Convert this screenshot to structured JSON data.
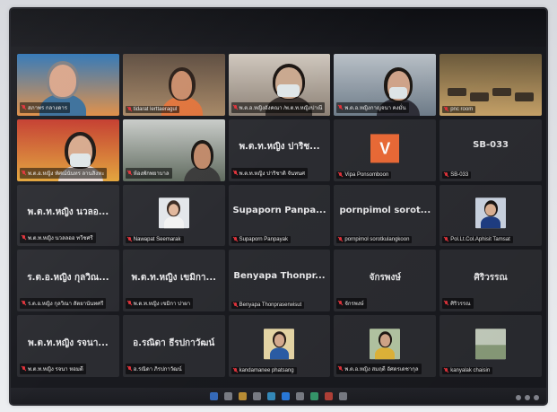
{
  "participants": [
    {
      "tag": "สภาพร กลางดาร",
      "type": "video"
    },
    {
      "tag": "tidarat lerttaeragul",
      "type": "video"
    },
    {
      "tag": "พ.ต.อ.หญิงอังคณา /พ.ต.ท.หญิงปาณี",
      "type": "video",
      "active": true
    },
    {
      "tag": "พ.ต.อ.หญิงกาญจนา คงมั่น",
      "type": "video"
    },
    {
      "tag": "pnc room",
      "type": "video"
    },
    {
      "tag": "พ.ต.อ.หญิง ทัศณ์นันทร ลานสิงหะ",
      "type": "video"
    },
    {
      "tag": "ห้องพักพยาบาล",
      "type": "video"
    },
    {
      "center": "พ.ต.ท.หญิง ปาริช...",
      "tag": "พ.ต.ท.หญิง ปาริชาติ จันทนศ",
      "type": "name"
    },
    {
      "tag": "Vipa Ponsomboon",
      "type": "avatar",
      "avatar_letter": "V"
    },
    {
      "center": "SB-033",
      "tag": "SB-033",
      "type": "name"
    },
    {
      "center": "พ.ต.ท.หญิง นวลอ...",
      "tag": "พ.ต.ท.หญิง นวลลออ ทวีชศรี",
      "type": "name"
    },
    {
      "tag": "Nawapat Seemarak",
      "type": "photo"
    },
    {
      "center": "Supaporn Panpa...",
      "tag": "Supaporn Panpayak",
      "type": "name"
    },
    {
      "center": "pornpimol sorot...",
      "tag": "pornpimol sorotkulangkoon",
      "type": "name"
    },
    {
      "tag": "Pol.Lt.Col.Aphisit Tamsat",
      "type": "photo"
    },
    {
      "center": "ร.ต.อ.หญิง กุลวิณ...",
      "tag": "ร.ต.อ.หญิง กุลวิณา สัตยานันทศรี",
      "type": "name"
    },
    {
      "center": "พ.ต.ท.หญิง เขมิกา...",
      "tag": "พ.ต.ท.หญิง เขมิกา ปาผา",
      "type": "name"
    },
    {
      "center": "Benyapa Thonpr...",
      "tag": "Benyapa Thonpraserwisut",
      "type": "name"
    },
    {
      "center": "จักรพงษ์",
      "tag": "จักรพงษ์",
      "type": "name"
    },
    {
      "center": "ศิริวรรณ",
      "tag": "ศิริวรรณ",
      "type": "name"
    },
    {
      "center": "พ.ต.ท.หญิง รจนา...",
      "tag": "พ.ต.ท.หญิง รจนา หอมดี",
      "type": "name"
    },
    {
      "center": "อ.รณิดา ธีรปกาวัฒน์",
      "tag": "อ.รณิดา ภิรปกาวัฒน์",
      "type": "name"
    },
    {
      "tag": "kandamanee phatsang",
      "type": "photo"
    },
    {
      "tag": "พ.ต.อ.หญิง สมฤดี อัศดรเดชากุล",
      "type": "photo"
    },
    {
      "tag": "kanyalak chaisin",
      "type": "photo"
    }
  ],
  "colors": {
    "screen": "#191a1f",
    "tile": "#2b2c31",
    "active_outline": "#c9d44a",
    "mute": "#e0333b",
    "avatar_bg": "#ea6a37"
  },
  "icons": [
    "mic-off-icon",
    "taskbar-app-icon"
  ]
}
